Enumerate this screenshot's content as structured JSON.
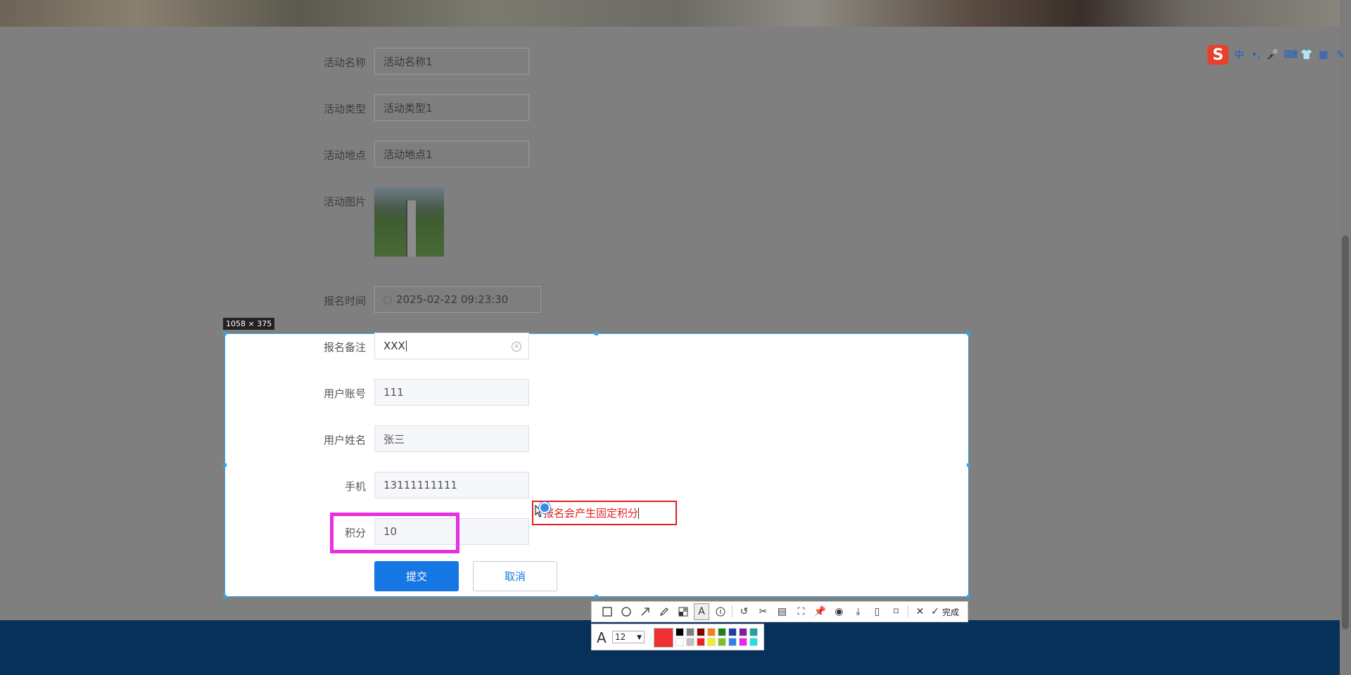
{
  "form": {
    "activity_name": {
      "label": "活动名称",
      "value": "活动名称1"
    },
    "activity_type": {
      "label": "活动类型",
      "value": "活动类型1"
    },
    "activity_place": {
      "label": "活动地点",
      "value": "活动地点1"
    },
    "activity_image": {
      "label": "活动图片"
    },
    "signup_time": {
      "label": "报名时间",
      "value": "2025-02-22 09:23:30"
    },
    "signup_note": {
      "label": "报名备注",
      "value": "XXX"
    },
    "user_account": {
      "label": "用户账号",
      "value": "111"
    },
    "user_name": {
      "label": "用户姓名",
      "value": "张三"
    },
    "phone": {
      "label": "手机",
      "value": "13111111111"
    },
    "points": {
      "label": "积分",
      "value": "10"
    },
    "submit_label": "提交",
    "cancel_label": "取消"
  },
  "screenshot_tool": {
    "selection_size": "1058 × 375",
    "annotation_text": "报名会产生固定积分",
    "done_label": "完成",
    "font_size": "12",
    "current_color": "#f03030",
    "highlight_color": "#e830e0",
    "tools": [
      "rectangle-icon",
      "ellipse-icon",
      "arrow-icon",
      "pen-icon",
      "mosaic-icon",
      "text-icon",
      "number-icon",
      "undo-icon",
      "scissors-icon",
      "ocr-icon",
      "scan-icon",
      "pin-icon",
      "record-icon",
      "download-icon",
      "long-screenshot-icon",
      "bookmark-icon",
      "close-icon",
      "check-icon"
    ],
    "palette": [
      "#000000",
      "#808080",
      "#800000",
      "#f08020",
      "#208020",
      "#2040a0",
      "#8020a0",
      "#20a0a0",
      "#ffffff",
      "#c0c0c0",
      "#f02020",
      "#f0f020",
      "#80c020",
      "#3080f0",
      "#f020f0",
      "#20e0e0"
    ]
  },
  "ime": {
    "brand": "S",
    "mode": "中"
  }
}
